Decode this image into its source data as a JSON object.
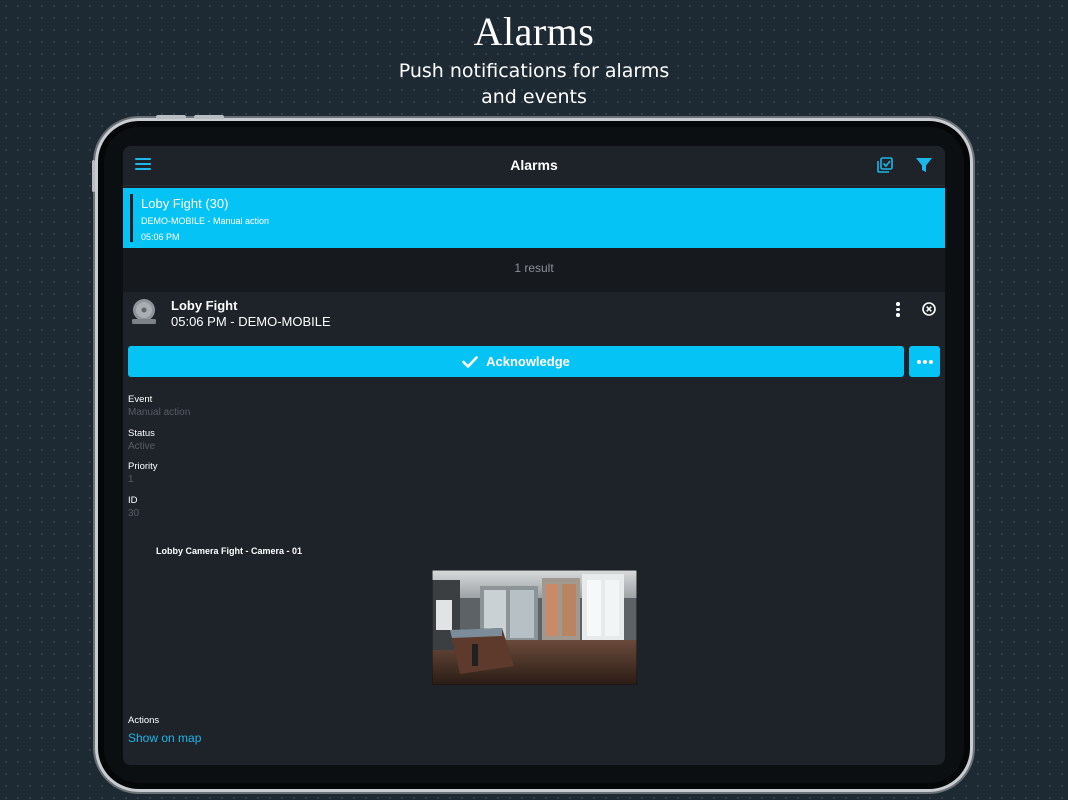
{
  "hero": {
    "title": "Alarms",
    "subtitle": "Push notifications for alarms and events"
  },
  "navbar": {
    "title": "Alarms",
    "menu_icon": "hamburger-menu-icon",
    "select_icon": "multi-select-icon",
    "filter_icon": "filter-funnel-icon",
    "accent_color": "#1fb6e8"
  },
  "alarm_list": {
    "items": [
      {
        "title": "Loby Fight (30)",
        "subtitle": "DEMO-MOBILE - Manual action",
        "time": "05:06 PM",
        "highlight_color": "#06c3f5"
      }
    ],
    "result_count": "1 result"
  },
  "detail": {
    "title": "Loby Fight",
    "subtitle": "05:06 PM - DEMO-MOBILE",
    "alarm_icon": "alarm-bell-icon",
    "acknowledge_label": "Acknowledge",
    "fields": [
      {
        "label": "Event",
        "value": "Manual action"
      },
      {
        "label": "Status",
        "value": "Active"
      },
      {
        "label": "Priority",
        "value": "1"
      },
      {
        "label": "ID",
        "value": "30"
      }
    ],
    "camera_title": "Lobby Camera Fight - Camera - 01",
    "actions_label": "Actions",
    "show_on_map": "Show on map"
  }
}
